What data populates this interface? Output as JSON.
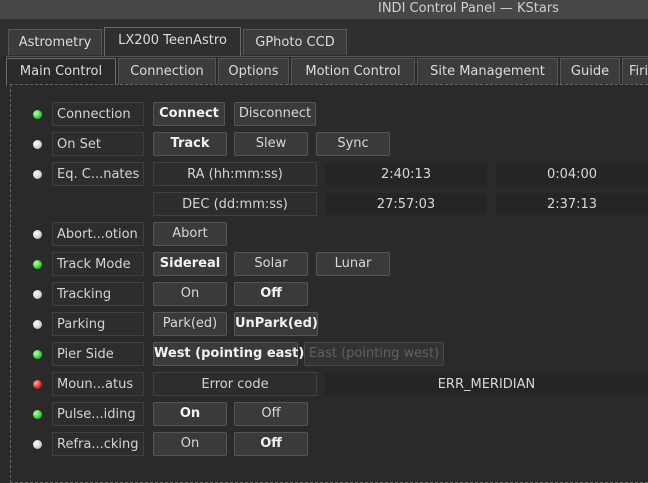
{
  "window": {
    "title": "INDI Control Panel — KStars"
  },
  "device_tabs": [
    {
      "label": "Astrometry",
      "active": false
    },
    {
      "label": "LX200 TeenAstro",
      "active": true
    },
    {
      "label": "GPhoto CCD",
      "active": false
    }
  ],
  "group_tabs": [
    {
      "label": "Main Control",
      "active": true
    },
    {
      "label": "Connection",
      "active": false
    },
    {
      "label": "Options",
      "active": false
    },
    {
      "label": "Motion Control",
      "active": false
    },
    {
      "label": "Site Management",
      "active": false
    },
    {
      "label": "Guide",
      "active": false
    },
    {
      "label": "Firi",
      "active": false
    }
  ],
  "properties": {
    "connection": {
      "label": "Connection",
      "status": "green",
      "buttons": [
        "Connect",
        "Disconnect"
      ]
    },
    "on_set": {
      "label": "On Set",
      "status": "white",
      "buttons": [
        "Track",
        "Slew",
        "Sync"
      ]
    },
    "eq_coords": {
      "label": "Eq. C...nates",
      "status": "white",
      "ra_label": "RA (hh:mm:ss)",
      "ra_value": "2:40:13",
      "ra_input": "0:04:00",
      "dec_label": "DEC (dd:mm:ss)",
      "dec_value": "27:57:03",
      "dec_input": "2:37:13"
    },
    "abort_motion": {
      "label": "Abort...otion",
      "status": "white",
      "buttons": [
        "Abort"
      ]
    },
    "track_mode": {
      "label": "Track Mode",
      "status": "green",
      "buttons": [
        "Sidereal",
        "Solar",
        "Lunar"
      ]
    },
    "tracking": {
      "label": "Tracking",
      "status": "white",
      "buttons": [
        "On",
        "Off"
      ]
    },
    "parking": {
      "label": "Parking",
      "status": "white",
      "buttons": [
        "Park(ed)",
        "UnPark(ed)"
      ]
    },
    "pier_side": {
      "label": "Pier Side",
      "status": "green",
      "buttons": [
        "West (pointing east)",
        "East (pointing west)"
      ]
    },
    "mount_status": {
      "label": "Moun...atus",
      "status": "red",
      "field_label": "Error code",
      "field_value": "ERR_MERIDIAN"
    },
    "pulse_guiding": {
      "label": "Pulse...iding",
      "status": "green",
      "buttons": [
        "On",
        "Off"
      ]
    },
    "refraction": {
      "label": "Refra...cking",
      "status": "white",
      "buttons": [
        "On",
        "Off"
      ]
    }
  }
}
